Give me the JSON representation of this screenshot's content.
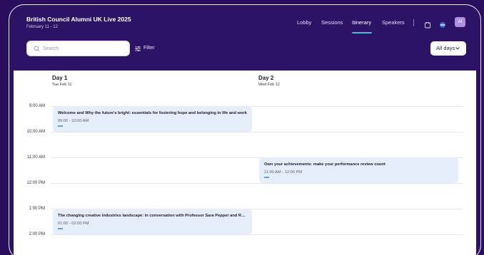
{
  "header": {
    "title": "British Council Alumni UK Live 2025",
    "dates": "February 11 - 12",
    "nav": [
      "Lobby",
      "Sessions",
      "Itinerary",
      "Speakers"
    ],
    "active_nav": "Itinerary",
    "avatar_initials": "AI"
  },
  "toolbar": {
    "search_placeholder": "Search",
    "filter_label": "Filter",
    "days_select": "All days"
  },
  "days": [
    {
      "label": "Day 1",
      "date": "Tue Feb 11"
    },
    {
      "label": "Day 2",
      "date": "Wed Feb 12"
    }
  ],
  "time_slots": [
    "9:00 AM",
    "10:00 AM",
    "11:00 AM",
    "12:00 PM",
    "1:00 PM",
    "2:00 PM"
  ],
  "sessions": [
    {
      "title": "Welcome and Why the future's bright: essentials for fostering hope and belonging in life and work",
      "time": "09:00 - 10:00 AM",
      "day": 1
    },
    {
      "title": "Own your achievements: make your performance review count",
      "time": "11:00 AM - 12:00 PM",
      "day": 2
    },
    {
      "title": "The changing creative industries landscape: in conversation with Professor Sara Pepper and Reh...",
      "time": "01:00 - 02:00 PM",
      "day": 1
    }
  ],
  "colors": {
    "header_bg": "#2d1366",
    "accent": "#3fc0cf",
    "session_bg": "#e6eefb"
  }
}
